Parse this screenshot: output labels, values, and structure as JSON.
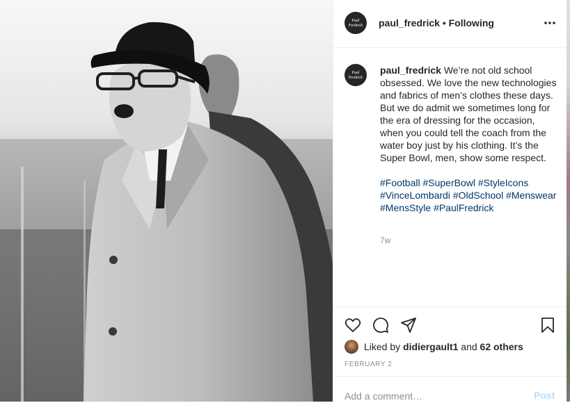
{
  "post": {
    "avatar_text_line1": "Paul",
    "avatar_text_line2": "Fredrick",
    "username": "paul_fredrick",
    "separator": "•",
    "follow_status": "Following",
    "more_icon": "more-horizontal-icon"
  },
  "caption": {
    "author": "paul_fredrick",
    "text": "We’re not old school obsessed. We love the new technologies and fabrics of men’s clothes these days. But we do admit we sometimes long for the era of dressing for the occasion, when you could tell the coach from the water boy just by his clothing. It’s the Super Bowl, men, show some respect.",
    "hashtags": [
      "#Football",
      "#SuperBowl",
      "#StyleIcons",
      "#VinceLombardi",
      "#OldSchool",
      "#Menswear",
      "#MensStyle",
      "#PaulFredrick"
    ],
    "age": "7w"
  },
  "actions": {
    "like_icon": "heart-icon",
    "comment_icon": "comment-icon",
    "share_icon": "share-icon",
    "save_icon": "bookmark-icon"
  },
  "likes": {
    "prefix": "Liked by",
    "user": "didiergault1",
    "conjunction": "and",
    "others": "62 others"
  },
  "date": "FEBRUARY 2",
  "comment": {
    "placeholder": "Add a comment…",
    "post_label": "Post"
  }
}
